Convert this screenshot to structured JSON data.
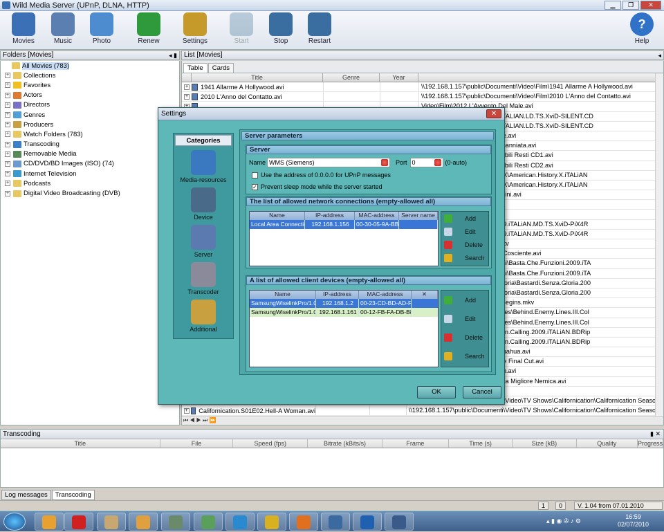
{
  "window": {
    "title": "Wild Media Server (UPnP, DLNA, HTTP)"
  },
  "toolbar": {
    "items": [
      {
        "label": "Movies",
        "icon": "movies-icon",
        "color": "#3b6fb6"
      },
      {
        "label": "Music",
        "icon": "music-icon",
        "color": "#5a7fb0"
      },
      {
        "label": "Photo",
        "icon": "photo-icon",
        "color": "#4d8ccf"
      },
      {
        "label": "Renew",
        "icon": "renew-icon",
        "color": "#2f9a3c"
      },
      {
        "label": "Settings",
        "icon": "settings-icon",
        "color": "#c59a2a"
      },
      {
        "label": "Start",
        "icon": "start-icon",
        "color": "#4a7a9a"
      },
      {
        "label": "Stop",
        "icon": "stop-icon",
        "color": "#3a6da0"
      },
      {
        "label": "Restart",
        "icon": "restart-icon",
        "color": "#3a6da0"
      },
      {
        "label": "Help",
        "icon": "help-icon",
        "color": "#2f72c8"
      }
    ]
  },
  "folders": {
    "header": "Folders [Movies]",
    "items": [
      {
        "label": "All Movies (783)",
        "color": "#e8c860"
      },
      {
        "label": "Collections",
        "color": "#e8c860"
      },
      {
        "label": "Favorites",
        "color": "#f0c020"
      },
      {
        "label": "Actors",
        "color": "#e07a30"
      },
      {
        "label": "Directors",
        "color": "#7a70c8"
      },
      {
        "label": "Genres",
        "color": "#50a0d8"
      },
      {
        "label": "Producers",
        "color": "#c8a040"
      },
      {
        "label": "Watch Folders (783)",
        "color": "#e8c860"
      },
      {
        "label": "Transcoding",
        "color": "#3a80c8"
      },
      {
        "label": "Removable Media",
        "color": "#5a8a5a"
      },
      {
        "label": "CD/DVD/BD Images (ISO) (74)",
        "color": "#6a9ad0"
      },
      {
        "label": "Internet Television",
        "color": "#3a9ad0"
      },
      {
        "label": "Podcasts",
        "color": "#e8c860"
      },
      {
        "label": "Digital Video Broadcasting (DVB)",
        "color": "#e8c860"
      }
    ]
  },
  "list": {
    "header": "List [Movies]",
    "tabs": [
      "Table",
      "Cards"
    ],
    "columns": [
      "Title",
      "Genre",
      "Year"
    ],
    "rows": [
      {
        "title": "1941 Allarme A Hollywood.avi",
        "path": "\\\\192.168.1.157\\public\\Documenti\\Video\\Film\\1941 Allarme A Hollywood.avi"
      },
      {
        "title": "2010 L'Anno del Contatto.avi",
        "path": "\\\\192.168.1.157\\public\\Documenti\\Video\\Film\\2010 L'Anno del Contatto.avi"
      },
      {
        "title": "",
        "path": "Video\\Film\\2012 L'Avvento Del Male.avi"
      },
      {
        "title": "",
        "path": "Video\\Film\\2012\\2012.2009.iTALIAN.LD.TS.XviD-SILENT.CD"
      },
      {
        "title": "",
        "path": "Video\\Film\\2012\\2012.2009.iTALIAN.LD.TS.XviD-SILENT.CD"
      },
      {
        "title": "",
        "path": "Video\\Film\\500 Giorni Insieme.avi"
      },
      {
        "title": "",
        "path": "Video\\Filmati Telecamera\\Abbanniata.avi"
      },
      {
        "title": "",
        "path": "Video\\Film\\Amabili Resti\\Amabili Resti CD1.avi"
      },
      {
        "title": "",
        "path": "Video\\Film\\Amabili Resti\\Amabili Resti CD2.avi"
      },
      {
        "title": "",
        "path": "Video\\Film\\American History X\\American.History.X.iTALiAN"
      },
      {
        "title": "",
        "path": "Video\\Film\\American History X\\American.History.X.iTALiAN"
      },
      {
        "title": "",
        "path": "Video\\Film\\Amore E Altri Crimini.avi"
      },
      {
        "title": "",
        "path": "Video\\Film\\Anno Uno.avi"
      },
      {
        "title": "",
        "path": "Video\\Film\\Appaloosa.avi"
      },
      {
        "title": "",
        "path": "Video\\Film\\Avatar\\Avatar.2009.iTALiAN.MD.TS.XviD-PiX4R"
      },
      {
        "title": "",
        "path": "Video\\Film\\Avatar\\Avatar.2009.iTALiAN.MD.TS.XviD-PiX4R"
      },
      {
        "title": "",
        "path": "Video\\Film\\HD Film\\Avatar.mkv"
      },
      {
        "title": "",
        "path": "Video\\Film\\Awake Anestesia Cosciente.avi"
      },
      {
        "title": "",
        "path": "Video\\Film\\Basta che Funzioni\\Basta.Che.Funzioni.2009.iTA"
      },
      {
        "title": "",
        "path": "Video\\Film\\Basta che Funzioni\\Basta.Che.Funzioni.2009.iTA"
      },
      {
        "title": "",
        "path": "Video\\Film\\Bastardi Senza Gloria\\Bastardi.Senza.Gloria.200"
      },
      {
        "title": "",
        "path": "Video\\Film\\Bastardi Senza Gloria\\Bastardi.Senza.Gloria.200"
      },
      {
        "title": "",
        "path": "Video\\Film\\HD Film\\Batman Begins.mkv"
      },
      {
        "title": "",
        "path": "Video\\Film\\Behind Enemy Lines\\Behind.Enemy.Lines.III.Col"
      },
      {
        "title": "",
        "path": "Video\\Film\\Behind Enemy Lines\\Behind.Enemy.Lines.III.Col"
      },
      {
        "title": "",
        "path": "Video\\Film\\Berlin Calling\\Berlin.Calling.2009.iTALiAN.BDRip"
      },
      {
        "title": "",
        "path": "Video\\Film\\Berlin Calling\\Berlin.Calling.2009.iTALiAN.BDRip"
      },
      {
        "title": "",
        "path": "Video\\Film\\Beverly Hills Chihuahua.avi"
      },
      {
        "title": "",
        "path": "Video\\Film\\Blade Runner -The Final Cut.avi"
      },
      {
        "title": "",
        "path": "Video\\Film\\Blow - Jonny Deep.avi"
      },
      {
        "title": "",
        "path": "Video\\Film\\Bride Wars - La Mia Migliore Nemica.avi"
      },
      {
        "title": "",
        "path": "Video\\Film\\Burn Up.avi"
      },
      {
        "title": "Californication.S01E01.Pilot.avi",
        "path": "\\\\192.168.1.157\\public\\Documenti\\Video\\TV Shows\\Californication\\Californication Season01\\Cal"
      },
      {
        "title": "Californication.S01E02.Hell-A Woman.avi",
        "path": "\\\\192.168.1.157\\public\\Documenti\\Video\\TV Shows\\Californication\\Californication Season01\\Cal"
      }
    ]
  },
  "transcoding": {
    "header": "Transcoding",
    "columns": [
      "Title",
      "File",
      "Speed (fps)",
      "Bitrate (kBits/s)",
      "Frame",
      "Time (s)",
      "Size (kB)",
      "Quality",
      "Progress"
    ]
  },
  "logtabs": [
    "Log messages",
    "Transcoding"
  ],
  "status": {
    "a": "1",
    "b": "0",
    "version": "V. 1.04 from 07.01.2010"
  },
  "taskbar": {
    "time": "16:59",
    "date": "02/07/2010",
    "apps": [
      "#e8a030",
      "#d02020",
      "#c8a870",
      "#e0a040",
      "#6a8a6a",
      "#5aa05a",
      "#2a8ad0",
      "#d8b020",
      "#e07020",
      "#3a6aa0",
      "#2060b0",
      "#3a5a8a"
    ]
  },
  "dialog": {
    "title": "Settings",
    "categories_header": "Categories",
    "categories": [
      {
        "label": "Media-resources",
        "color": "#3a78c0"
      },
      {
        "label": "Device",
        "color": "#4a6a8a"
      },
      {
        "label": "Server",
        "color": "#5a7ab0"
      },
      {
        "label": "Transcoder",
        "color": "#8a8a9a"
      },
      {
        "label": "Additional",
        "color": "#c8a040"
      }
    ],
    "section": "Server parameters",
    "server": {
      "header": "Server",
      "name_label": "Name",
      "name_value": "WMS (Siemens)",
      "port_label": "Port",
      "port_value": "0",
      "port_hint": "(0-auto)",
      "opt1": "Use the address of 0.0.0.0 for UPnP messages",
      "opt2": "Prevent sleep mode while the server started"
    },
    "net": {
      "header": "The list of allowed network connections (empty-allowed all)",
      "columns": [
        "Name",
        "IP-address",
        "MAC-address",
        "Server name"
      ],
      "rows": [
        {
          "name": "Local Area Connectio",
          "ip": "192.168.1.156",
          "mac": "00-30-05-9A-BB-",
          "srv": ""
        }
      ]
    },
    "clients": {
      "header": "A list of allowed client devices (empty-allowed all)",
      "columns": [
        "Name",
        "IP-address",
        "MAC-address"
      ],
      "rows": [
        {
          "name": "SamsungWiselinkPro/1.0",
          "ip": "192.168.1.2",
          "mac": "00-23-CD-BD-AD-F1"
        },
        {
          "name": "SamsungWiselinkPro/1.0",
          "ip": "192.168.1.161",
          "mac": "00-12-FB-FA-DB-B8"
        }
      ]
    },
    "buttons": {
      "add": "Add",
      "edit": "Edit",
      "delete": "Delete",
      "search": "Search",
      "ok": "OK",
      "cancel": "Cancel"
    }
  }
}
